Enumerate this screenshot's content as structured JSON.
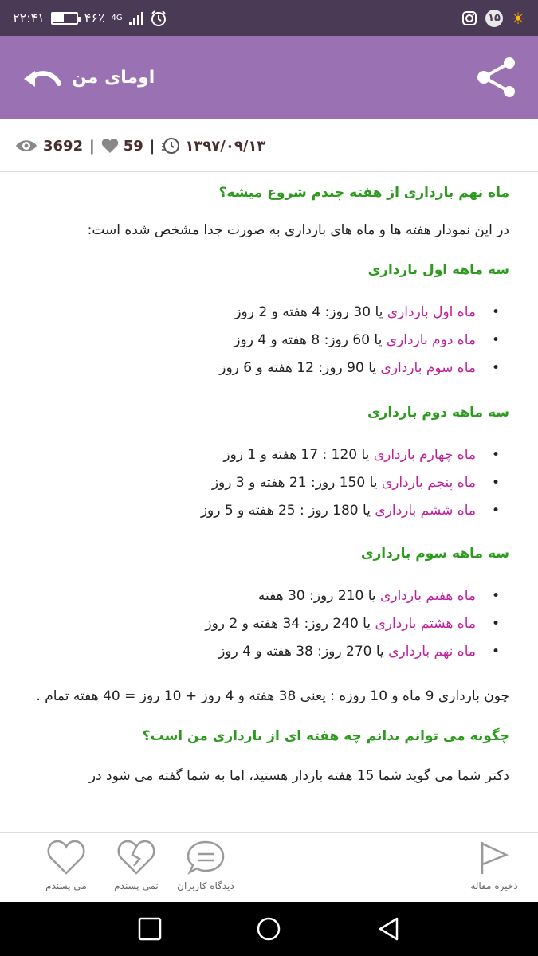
{
  "status_bar": {
    "time": "۲۲:۴۱",
    "battery": "۴۶٪",
    "network": "4G",
    "notification_count": "۱۵",
    "battery_level": 0.46
  },
  "app_bar": {
    "title": "اومای من"
  },
  "meta": {
    "views": "3692",
    "likes": "59",
    "date": "۱۳۹۷/۰۹/۱۳"
  },
  "article": {
    "heading1": "ماه نهم بارداری از هفته چندم شروع میشه؟",
    "intro": "در این نمودار هفته ها و ماه های بارداری به صورت جدا مشخص شده است:",
    "sections": [
      {
        "title": "سه ماهه اول بارداری",
        "items": [
          {
            "month": "ماه اول بارداری",
            "rest": " یا 30 روز: 4 هفته و 2 روز"
          },
          {
            "month": "ماه دوم بارداری",
            "rest": " یا 60 روز: 8 هفته و 4 روز"
          },
          {
            "month": "ماه سوم بارداری",
            "rest": " یا 90 روز: 12 هفته و 6 روز"
          }
        ]
      },
      {
        "title": "سه ماهه دوم بارداری",
        "items": [
          {
            "month": "ماه چهارم بارداری",
            "rest": " یا 120 : 17 هفته و 1 روز"
          },
          {
            "month": "ماه پنجم بارداری",
            "rest": " یا 150 روز: 21 هفته و 3 روز"
          },
          {
            "month": "ماه ششم بارداری",
            "rest": " یا 180 روز : 25 هفته و 5 روز"
          }
        ]
      },
      {
        "title": "سه ماهه سوم بارداری",
        "items": [
          {
            "month": "ماه هفتم بارداری",
            "rest": " یا 210 روز: 30 هفته"
          },
          {
            "month": "ماه هشتم بارداری",
            "rest": " یا 240 روز: 34 هفته و 2 روز"
          },
          {
            "month": "ماه نهم بارداری",
            "rest": " یا 270 روز: 38 هفته و 4 روز"
          }
        ]
      }
    ],
    "summary": "چون بارداری 9 ماه و 10 روزه : یعنی 38 هفته و 4 روز + 10 روز = 40 هفته تمام .",
    "heading2": "چگونه می توانم بدانم چه هفته ای از بارداری من است؟",
    "para2": "دکتر شما می گوید شما 15 هفته باردار هستید، اما به شما گفته می شود در"
  },
  "bottom_actions": {
    "like": "می پسندم",
    "dislike": "نمی پسندم",
    "comments": "دیدگاه کاربران",
    "save": "ذخیره مقاله"
  },
  "colors": {
    "status_bar": "#4a3a56",
    "app_bar": "#9a71b3",
    "heading_green": "#2d9a1f",
    "highlight_magenta": "#c0209a"
  }
}
